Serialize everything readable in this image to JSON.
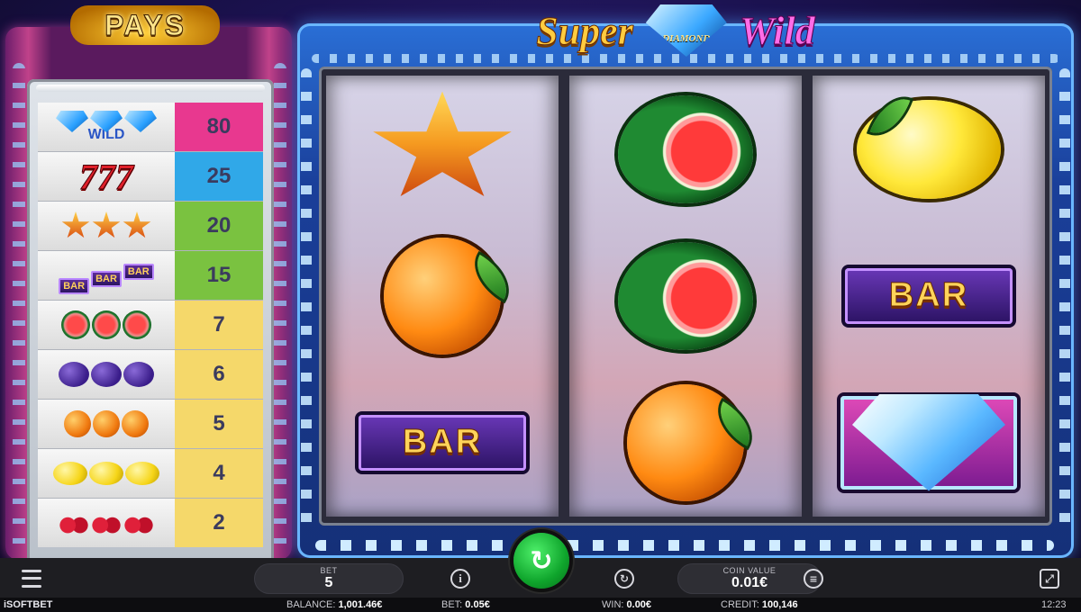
{
  "game": {
    "logo_word_left": "Super",
    "logo_word_center": "DIAMOND",
    "logo_word_right": "Wild",
    "colors": {
      "logo_gold": "#ffcc40",
      "logo_pink": "#ff6de8",
      "spin_green": "#0fa52c"
    }
  },
  "paytable": {
    "title": "PAYS",
    "rows": [
      {
        "symbol": "wild-diamond",
        "label": "WILD",
        "value": "80",
        "color": "#e8388f"
      },
      {
        "symbol": "seven",
        "label": "777",
        "value": "25",
        "color": "#30a8e8"
      },
      {
        "symbol": "star",
        "label": "",
        "value": "20",
        "color": "#7ac240"
      },
      {
        "symbol": "bar",
        "label": "BAR",
        "value": "15",
        "color": "#7ac240"
      },
      {
        "symbol": "watermelon",
        "label": "",
        "value": "7",
        "color": "#f5d86a"
      },
      {
        "symbol": "plum",
        "label": "",
        "value": "6",
        "color": "#f5d86a"
      },
      {
        "symbol": "orange",
        "label": "",
        "value": "5",
        "color": "#f5d86a"
      },
      {
        "symbol": "lemon",
        "label": "",
        "value": "4",
        "color": "#f5d86a"
      },
      {
        "symbol": "cherry",
        "label": "",
        "value": "2",
        "color": "#f5d86a"
      }
    ]
  },
  "reels": [
    [
      "star",
      "orange",
      "bar"
    ],
    [
      "watermelon",
      "watermelon",
      "orange"
    ],
    [
      "lemon",
      "bar",
      "diamond"
    ]
  ],
  "bar_symbol_text": "BAR",
  "controls": {
    "bet_label": "BET",
    "bet_value": "5",
    "coin_value_label": "COIN VALUE",
    "coin_value": "0.01€",
    "info_icon": "info-icon",
    "autoplay_icon": "autoplay-icon",
    "coins_icon": "coins-icon",
    "spin_icon": "spin-arrow-icon",
    "menu_icon": "hamburger-menu-icon",
    "fullscreen_icon": "fullscreen-icon"
  },
  "status": {
    "brand": "iSOFTBET",
    "balance_label": "BALANCE:",
    "balance_value": "1,001.46€",
    "bet_label": "BET:",
    "bet_value": "0.05€",
    "win_label": "WIN:",
    "win_value": "0.00€",
    "credit_label": "CREDIT:",
    "credit_value": "100,146",
    "clock": "12:23"
  }
}
